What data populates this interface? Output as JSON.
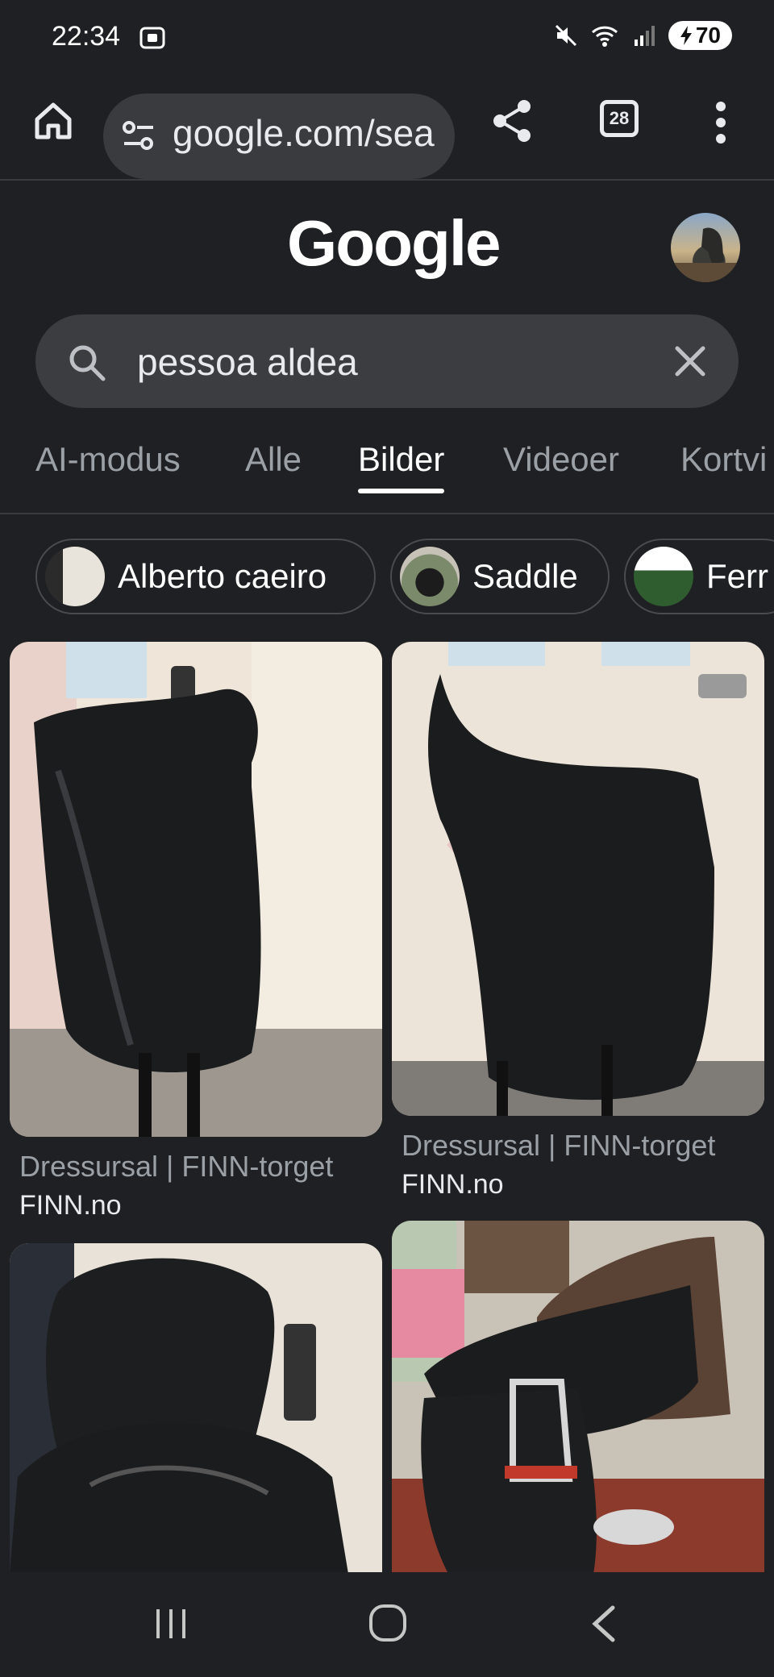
{
  "status_bar": {
    "time": "22:34",
    "battery": "70"
  },
  "browser": {
    "url": "google.com/sea"
  },
  "toolbar": {
    "tab_count": "28"
  },
  "google": {
    "logo": "Google"
  },
  "search": {
    "query": "pessoa aldea"
  },
  "tabs": [
    {
      "label": "AI-modus"
    },
    {
      "label": "Alle"
    },
    {
      "label": "Bilder",
      "active": true
    },
    {
      "label": "Videoer"
    },
    {
      "label": "Kortvi"
    }
  ],
  "chips": [
    {
      "label": "Alberto caeiro"
    },
    {
      "label": "Saddle"
    },
    {
      "label": "Ferr"
    }
  ],
  "results": [
    {
      "title": "Dressursal | FINN-torget",
      "source": "FINN.no"
    },
    {
      "title": "Dressursal | FINN-torget",
      "source": "FINN.no"
    },
    {
      "title": "",
      "source": ""
    },
    {
      "title": "",
      "source": ""
    }
  ],
  "colors": {
    "background": "#1f2023",
    "pill": "#3c3d41",
    "muted_text": "#9aa0a6",
    "text": "#e8eaed"
  }
}
